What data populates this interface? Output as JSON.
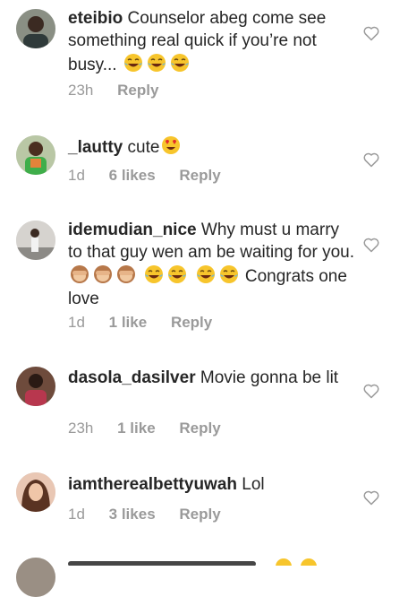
{
  "comments": [
    {
      "username": "eteibio",
      "text": "Counselor abeg come see something real quick if you’re not busy...",
      "emoji_after": [
        "tears-of-joy-emoji",
        "tears-of-joy-emoji",
        "tears-of-joy-emoji"
      ],
      "time": "23h",
      "likes": "",
      "reply_label": "Reply"
    },
    {
      "username": "_lautty",
      "text": "cute",
      "emoji_after": [
        "heart-eyes-emoji"
      ],
      "time": "1d",
      "likes": "6 likes",
      "reply_label": "Reply"
    },
    {
      "username": "idemudian_nice",
      "text": "Why must u marry to that guy wen am be waiting for you.",
      "emoji_after": [
        "see-no-evil-monkey-emoji",
        "see-no-evil-monkey-emoji",
        "see-no-evil-monkey-emoji",
        "tears-of-joy-emoji",
        "tears-of-joy-emoji",
        "tears-of-joy-emoji",
        "tears-of-joy-emoji"
      ],
      "text_tail": "Congrats one love",
      "time": "1d",
      "likes": "1 like",
      "reply_label": "Reply"
    },
    {
      "username": "dasola_dasilver",
      "text": "Movie gonna be lit",
      "emoji_after": [],
      "time": "23h",
      "likes": "1 like",
      "reply_label": "Reply"
    },
    {
      "username": "iamtherealbettyuwah",
      "text": "Lol",
      "emoji_after": [],
      "time": "1d",
      "likes": "3 likes",
      "reply_label": "Reply"
    }
  ],
  "colors": {
    "text": "#262626",
    "meta": "#9a9a9a",
    "heart_outline": "#9a9a9a",
    "emoji_yellow": "#f7c52c"
  }
}
